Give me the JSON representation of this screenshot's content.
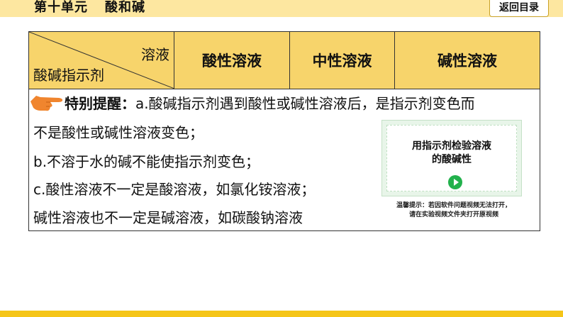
{
  "header": {
    "unit": "第十单元",
    "topic": "酸和碱",
    "back_label": "返回目录"
  },
  "table": {
    "corner_top": "溶液",
    "corner_bottom": "酸碱指示剂",
    "columns": [
      "酸性溶液",
      "中性溶液",
      "碱性溶液"
    ]
  },
  "notes": {
    "tip_label": "特别提醒：",
    "line1": "a.酸碱指示剂遇到酸性或碱性溶液后，是指示剂变色而",
    "line2": "不是酸性或碱性溶液变色；",
    "line3": "b.不溶于水的碱不能使指示剂变色；",
    "line4": "c.酸性溶液不一定是酸溶液，如氯化铵溶液；",
    "line5": "碱性溶液也不一定是碱溶液，如碳酸钠溶液"
  },
  "video": {
    "title_line1": "用指示剂检验溶液",
    "title_line2": "的酸碱性",
    "warm_tip_line1": "温馨提示：若因软件问题视频无法打开，",
    "warm_tip_line2": "请在实验视频文件夹打开原视频"
  },
  "colors": {
    "topbar": "#fde7a0",
    "header_row": "#f7d46b",
    "bottom_line": "#f5c518",
    "hand": "#f0852e",
    "play": "#22b14c"
  },
  "icons": {
    "hand": "pointing-hand-icon",
    "play": "play-icon"
  }
}
